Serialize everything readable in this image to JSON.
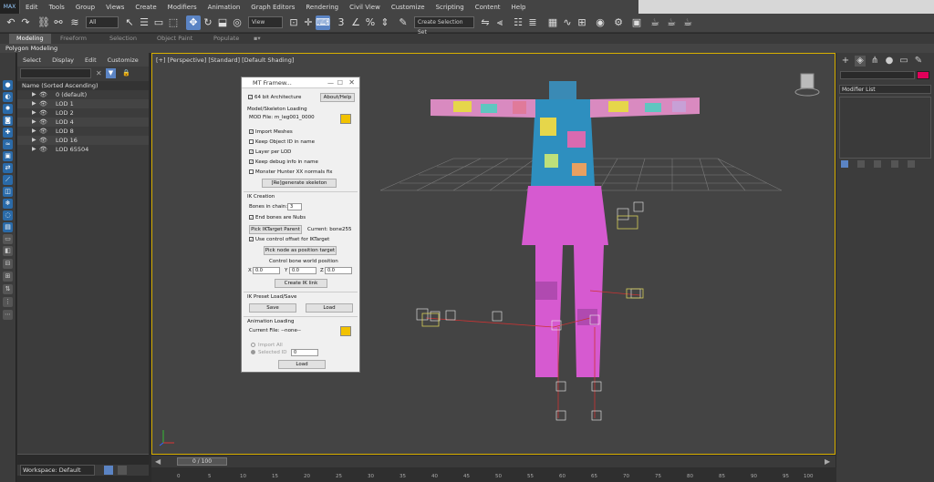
{
  "menubar": {
    "logo": "MAX",
    "items": [
      "Edit",
      "Tools",
      "Group",
      "Views",
      "Create",
      "Modifiers",
      "Animation",
      "Graph Editors",
      "Rendering",
      "Civil View",
      "Customize",
      "Scripting",
      "Content",
      "Help"
    ]
  },
  "toolbar": {
    "filter_value": "All",
    "view_value": "View",
    "selection_set_value": "Create Selection Set"
  },
  "ribbon": {
    "tabs": [
      "Modeling",
      "Freeform",
      "Selection",
      "Object Paint",
      "Populate"
    ],
    "active_tab": "Modeling",
    "subtitle": "Polygon Modeling"
  },
  "explorer": {
    "menu": [
      "Select",
      "Display",
      "Edit",
      "Customize"
    ],
    "column_header": "Name (Sorted Ascending)",
    "rows": [
      "0 (default)",
      "LOD 1",
      "LOD 2",
      "LOD 4",
      "LOD 8",
      "LOD 16",
      "LOD 65504"
    ],
    "workspace_label": "Workspace: Default"
  },
  "viewport": {
    "label": "[+] [Perspective] [Standard] [Default Shading]"
  },
  "timeline": {
    "slider": "0 / 100",
    "ticks": [
      "0",
      "5",
      "10",
      "15",
      "20",
      "25",
      "30",
      "35",
      "40",
      "45",
      "50",
      "55",
      "60",
      "65",
      "70",
      "75",
      "80",
      "85",
      "90",
      "95",
      "100"
    ]
  },
  "dialog": {
    "title": "MT Framew...",
    "arch_label": "64 bit Architecture",
    "about_button": "About/Help",
    "model_section": "Model/Skeleton Loading",
    "mod_file": "MOD File: m_leg001_0000",
    "import_meshes": "Import Meshes",
    "keep_object_id": "Keep Object ID in name",
    "layer_per_lod": "Layer per LOD",
    "keep_debug": "Keep debug info in name",
    "mh_normals": "Monster Hunter XX normals fix",
    "regen_button": "[Re]generate skeleton",
    "ik_section": "IK Creation",
    "bones_label": "Bones in chain:",
    "bones_value": "3",
    "end_bones": "End bones are Nubs",
    "pick_parent": "Pick IKTarget Parent",
    "current_bone": "Current: bone255",
    "use_offset": "Use control offset for IKTarget",
    "pick_node": "Pick node as position target",
    "world_pos": "Control bone world position",
    "x_label": "X",
    "x_val": "0.0",
    "y_label": "Y",
    "y_val": "0.0",
    "z_label": "Z",
    "z_val": "0.0",
    "create_ik": "Create IK link",
    "preset_section": "IK Preset Load/Save",
    "save_button": "Save",
    "load_button": "Load",
    "anim_section": "Animation Loading",
    "current_file": "Current File: --none--",
    "import_all": "Import All",
    "selected_id": "Selected ID",
    "selected_id_value": "0",
    "load_anim_button": "Load"
  },
  "command_panel": {
    "modifier_list": "Modifier List"
  },
  "colors": {
    "accent": "#5b84c4",
    "viewport_border": "#d9b000",
    "object_color": "#e0005a"
  }
}
